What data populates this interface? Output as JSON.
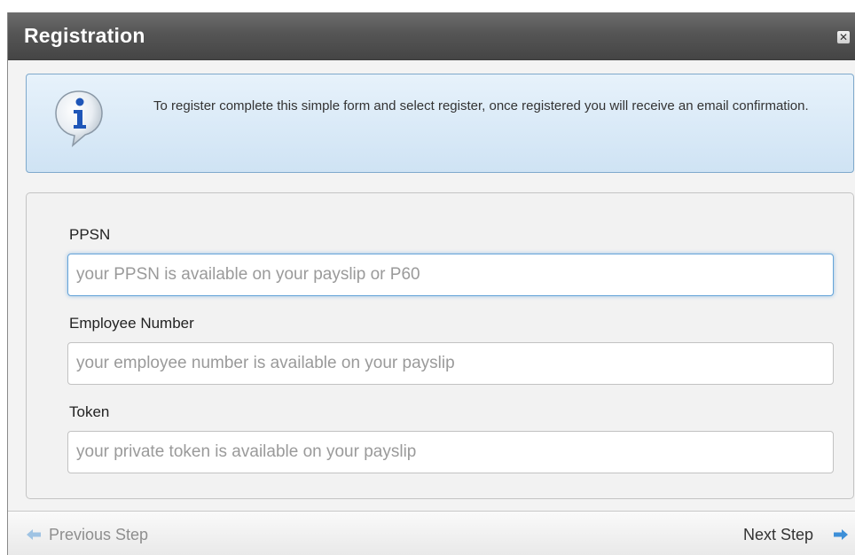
{
  "dialog": {
    "title": "Registration",
    "close_icon": "close-icon",
    "close_glyph": "✕"
  },
  "info": {
    "icon": "info-icon",
    "message": "To register complete this simple form and select register, once registered you will receive an email confirmation."
  },
  "form": {
    "fields": [
      {
        "label": "PPSN",
        "value": "",
        "placeholder": "your PPSN is available on your payslip or P60",
        "focused": true
      },
      {
        "label": "Employee Number",
        "value": "",
        "placeholder": "your employee number is available on your payslip",
        "focused": false
      },
      {
        "label": "Token",
        "value": "",
        "placeholder": "your private token is available on your payslip",
        "focused": false
      }
    ]
  },
  "footer": {
    "prev_label": "Previous Step",
    "next_label": "Next Step",
    "prev_icon": "arrow-left-icon",
    "next_icon": "arrow-right-icon"
  },
  "colors": {
    "titlebar": "#555555",
    "info_background": "#dbeaf7",
    "focus_border": "#66a4d9",
    "arrow": "#3d8fd8"
  }
}
